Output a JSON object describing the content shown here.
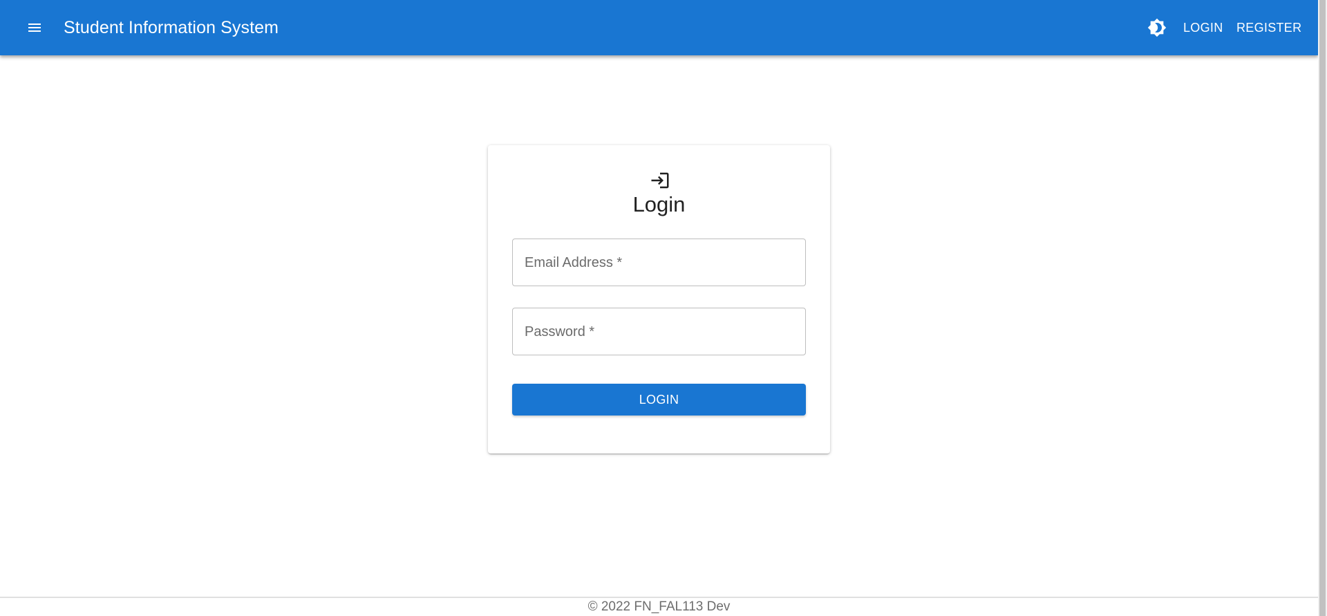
{
  "colors": {
    "primary": "#1976d2",
    "on_primary": "#ffffff",
    "field_border": "#bdbdbd",
    "label_text": "#6b6b6b"
  },
  "appbar": {
    "menu_icon": "menu-icon",
    "title": "Student Information System",
    "theme_icon": "brightness-icon",
    "nav": {
      "login_label": "LOGIN",
      "register_label": "REGISTER"
    }
  },
  "login_card": {
    "icon": "login-icon",
    "title": "Login",
    "email_label": "Email Address *",
    "password_label": "Password *",
    "submit_label": "LOGIN"
  },
  "footer": {
    "text": "© 2022 FN_FAL113 Dev"
  }
}
